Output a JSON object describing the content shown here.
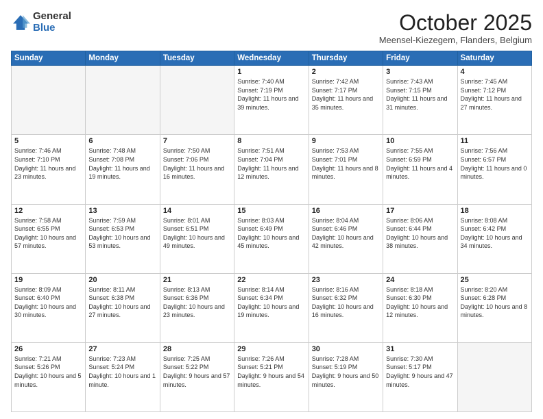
{
  "logo": {
    "general": "General",
    "blue": "Blue"
  },
  "title": "October 2025",
  "subtitle": "Meensel-Kiezegem, Flanders, Belgium",
  "headers": [
    "Sunday",
    "Monday",
    "Tuesday",
    "Wednesday",
    "Thursday",
    "Friday",
    "Saturday"
  ],
  "weeks": [
    [
      {
        "day": "",
        "info": ""
      },
      {
        "day": "",
        "info": ""
      },
      {
        "day": "",
        "info": ""
      },
      {
        "day": "1",
        "info": "Sunrise: 7:40 AM\nSunset: 7:19 PM\nDaylight: 11 hours\nand 39 minutes."
      },
      {
        "day": "2",
        "info": "Sunrise: 7:42 AM\nSunset: 7:17 PM\nDaylight: 11 hours\nand 35 minutes."
      },
      {
        "day": "3",
        "info": "Sunrise: 7:43 AM\nSunset: 7:15 PM\nDaylight: 11 hours\nand 31 minutes."
      },
      {
        "day": "4",
        "info": "Sunrise: 7:45 AM\nSunset: 7:12 PM\nDaylight: 11 hours\nand 27 minutes."
      }
    ],
    [
      {
        "day": "5",
        "info": "Sunrise: 7:46 AM\nSunset: 7:10 PM\nDaylight: 11 hours\nand 23 minutes."
      },
      {
        "day": "6",
        "info": "Sunrise: 7:48 AM\nSunset: 7:08 PM\nDaylight: 11 hours\nand 19 minutes."
      },
      {
        "day": "7",
        "info": "Sunrise: 7:50 AM\nSunset: 7:06 PM\nDaylight: 11 hours\nand 16 minutes."
      },
      {
        "day": "8",
        "info": "Sunrise: 7:51 AM\nSunset: 7:04 PM\nDaylight: 11 hours\nand 12 minutes."
      },
      {
        "day": "9",
        "info": "Sunrise: 7:53 AM\nSunset: 7:01 PM\nDaylight: 11 hours\nand 8 minutes."
      },
      {
        "day": "10",
        "info": "Sunrise: 7:55 AM\nSunset: 6:59 PM\nDaylight: 11 hours\nand 4 minutes."
      },
      {
        "day": "11",
        "info": "Sunrise: 7:56 AM\nSunset: 6:57 PM\nDaylight: 11 hours\nand 0 minutes."
      }
    ],
    [
      {
        "day": "12",
        "info": "Sunrise: 7:58 AM\nSunset: 6:55 PM\nDaylight: 10 hours\nand 57 minutes."
      },
      {
        "day": "13",
        "info": "Sunrise: 7:59 AM\nSunset: 6:53 PM\nDaylight: 10 hours\nand 53 minutes."
      },
      {
        "day": "14",
        "info": "Sunrise: 8:01 AM\nSunset: 6:51 PM\nDaylight: 10 hours\nand 49 minutes."
      },
      {
        "day": "15",
        "info": "Sunrise: 8:03 AM\nSunset: 6:49 PM\nDaylight: 10 hours\nand 45 minutes."
      },
      {
        "day": "16",
        "info": "Sunrise: 8:04 AM\nSunset: 6:46 PM\nDaylight: 10 hours\nand 42 minutes."
      },
      {
        "day": "17",
        "info": "Sunrise: 8:06 AM\nSunset: 6:44 PM\nDaylight: 10 hours\nand 38 minutes."
      },
      {
        "day": "18",
        "info": "Sunrise: 8:08 AM\nSunset: 6:42 PM\nDaylight: 10 hours\nand 34 minutes."
      }
    ],
    [
      {
        "day": "19",
        "info": "Sunrise: 8:09 AM\nSunset: 6:40 PM\nDaylight: 10 hours\nand 30 minutes."
      },
      {
        "day": "20",
        "info": "Sunrise: 8:11 AM\nSunset: 6:38 PM\nDaylight: 10 hours\nand 27 minutes."
      },
      {
        "day": "21",
        "info": "Sunrise: 8:13 AM\nSunset: 6:36 PM\nDaylight: 10 hours\nand 23 minutes."
      },
      {
        "day": "22",
        "info": "Sunrise: 8:14 AM\nSunset: 6:34 PM\nDaylight: 10 hours\nand 19 minutes."
      },
      {
        "day": "23",
        "info": "Sunrise: 8:16 AM\nSunset: 6:32 PM\nDaylight: 10 hours\nand 16 minutes."
      },
      {
        "day": "24",
        "info": "Sunrise: 8:18 AM\nSunset: 6:30 PM\nDaylight: 10 hours\nand 12 minutes."
      },
      {
        "day": "25",
        "info": "Sunrise: 8:20 AM\nSunset: 6:28 PM\nDaylight: 10 hours\nand 8 minutes."
      }
    ],
    [
      {
        "day": "26",
        "info": "Sunrise: 7:21 AM\nSunset: 5:26 PM\nDaylight: 10 hours\nand 5 minutes."
      },
      {
        "day": "27",
        "info": "Sunrise: 7:23 AM\nSunset: 5:24 PM\nDaylight: 10 hours\nand 1 minute."
      },
      {
        "day": "28",
        "info": "Sunrise: 7:25 AM\nSunset: 5:22 PM\nDaylight: 9 hours\nand 57 minutes."
      },
      {
        "day": "29",
        "info": "Sunrise: 7:26 AM\nSunset: 5:21 PM\nDaylight: 9 hours\nand 54 minutes."
      },
      {
        "day": "30",
        "info": "Sunrise: 7:28 AM\nSunset: 5:19 PM\nDaylight: 9 hours\nand 50 minutes."
      },
      {
        "day": "31",
        "info": "Sunrise: 7:30 AM\nSunset: 5:17 PM\nDaylight: 9 hours\nand 47 minutes."
      },
      {
        "day": "",
        "info": ""
      }
    ]
  ]
}
